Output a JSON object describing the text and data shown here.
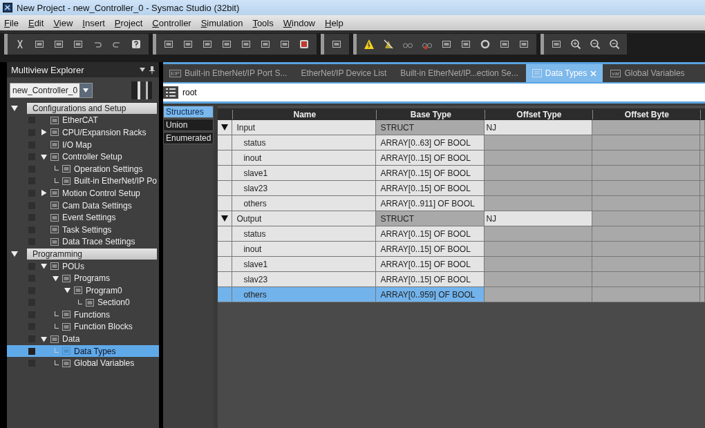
{
  "window": {
    "title": "New Project - new_Controller_0 - Sysmac Studio (32bit)"
  },
  "menu": [
    "File",
    "Edit",
    "View",
    "Insert",
    "Project",
    "Controller",
    "Simulation",
    "Tools",
    "Window",
    "Help"
  ],
  "explorer": {
    "title": "Multiview Explorer",
    "controller": "new_Controller_0",
    "tree": [
      {
        "label": "Configurations and Setup",
        "expanded": true,
        "selected": false,
        "children": [
          {
            "label": "EtherCAT",
            "selected": false
          },
          {
            "label": "CPU/Expansion Racks",
            "expanded": false,
            "selected": false
          },
          {
            "label": "I/O Map",
            "selected": false
          },
          {
            "label": "Controller Setup",
            "expanded": true,
            "selected": false,
            "children": [
              {
                "label": "Operation Settings",
                "connector": true,
                "selected": false
              },
              {
                "label": "Built-in EtherNet/IP Po",
                "connector": true,
                "selected": false
              }
            ]
          },
          {
            "label": "Motion Control Setup",
            "expanded": false,
            "selected": false
          },
          {
            "label": "Cam Data Settings",
            "selected": false
          },
          {
            "label": "Event Settings",
            "selected": false
          },
          {
            "label": "Task Settings",
            "selected": false
          },
          {
            "label": "Data Trace Settings",
            "selected": false
          }
        ]
      },
      {
        "label": "Programming",
        "expanded": true,
        "selected": false,
        "children": [
          {
            "label": "POUs",
            "expanded": true,
            "selected": false,
            "children": [
              {
                "label": "Programs",
                "expanded": true,
                "selected": false,
                "children": [
                  {
                    "label": "Program0",
                    "expanded": true,
                    "selected": false,
                    "children": [
                      {
                        "label": "Section0",
                        "connector": true,
                        "selected": false
                      }
                    ]
                  }
                ]
              },
              {
                "label": "Functions",
                "connector": true,
                "selected": false
              },
              {
                "label": "Function Blocks",
                "connector": true,
                "selected": false
              }
            ]
          },
          {
            "label": "Data",
            "expanded": true,
            "selected": false,
            "children": [
              {
                "label": "Data Types",
                "connector": true,
                "selected": true
              },
              {
                "label": "Global Variables",
                "connector": true,
                "selected": false
              }
            ]
          }
        ]
      }
    ]
  },
  "tabs": [
    {
      "label": "Built-in EtherNet/IP Port S...",
      "badge": "EIP",
      "selected": false
    },
    {
      "label": "EtherNet/IP Device List",
      "selected": false
    },
    {
      "label": "Built-in EtherNet/IP...ection Se...",
      "selected": false
    },
    {
      "label": "Data Types",
      "selected": true,
      "closable": true
    },
    {
      "label": "Global Variables",
      "badge": "var",
      "selected": false
    }
  ],
  "path": "root",
  "type_list": [
    {
      "label": "Structures",
      "selected": true
    },
    {
      "label": "Union",
      "selected": false
    },
    {
      "label": "Enumerated",
      "selected": false
    }
  ],
  "table": {
    "columns": [
      "Name",
      "Base Type",
      "Offset Type",
      "Offset Byte"
    ],
    "rows": [
      {
        "name": "Input",
        "base_type": "STRUCT",
        "offset_type": "NJ",
        "expanded": true,
        "selected": false,
        "children": [
          {
            "name": "status",
            "base_type": "ARRAY[0..63] OF BOOL",
            "selected": false
          },
          {
            "name": "inout",
            "base_type": "ARRAY[0..15] OF BOOL",
            "selected": false
          },
          {
            "name": "slave1",
            "base_type": "ARRAY[0..15] OF BOOL",
            "selected": false
          },
          {
            "name": "slav23",
            "base_type": "ARRAY[0..15] OF BOOL",
            "selected": false
          },
          {
            "name": "others",
            "base_type": "ARRAY[0..911] OF BOOL",
            "selected": false
          }
        ]
      },
      {
        "name": "Output",
        "base_type": "STRUCT",
        "offset_type": "NJ",
        "expanded": true,
        "selected": false,
        "children": [
          {
            "name": "status",
            "base_type": "ARRAY[0..15] OF BOOL",
            "selected": false
          },
          {
            "name": "inout",
            "base_type": "ARRAY[0..15] OF BOOL",
            "selected": false
          },
          {
            "name": "slave1",
            "base_type": "ARRAY[0..15] OF BOOL",
            "selected": false
          },
          {
            "name": "slav23",
            "base_type": "ARRAY[0..15] OF BOOL",
            "selected": false
          },
          {
            "name": "others",
            "base_type": "ARRAY[0..959] OF BOOL",
            "selected": true
          }
        ]
      }
    ]
  }
}
